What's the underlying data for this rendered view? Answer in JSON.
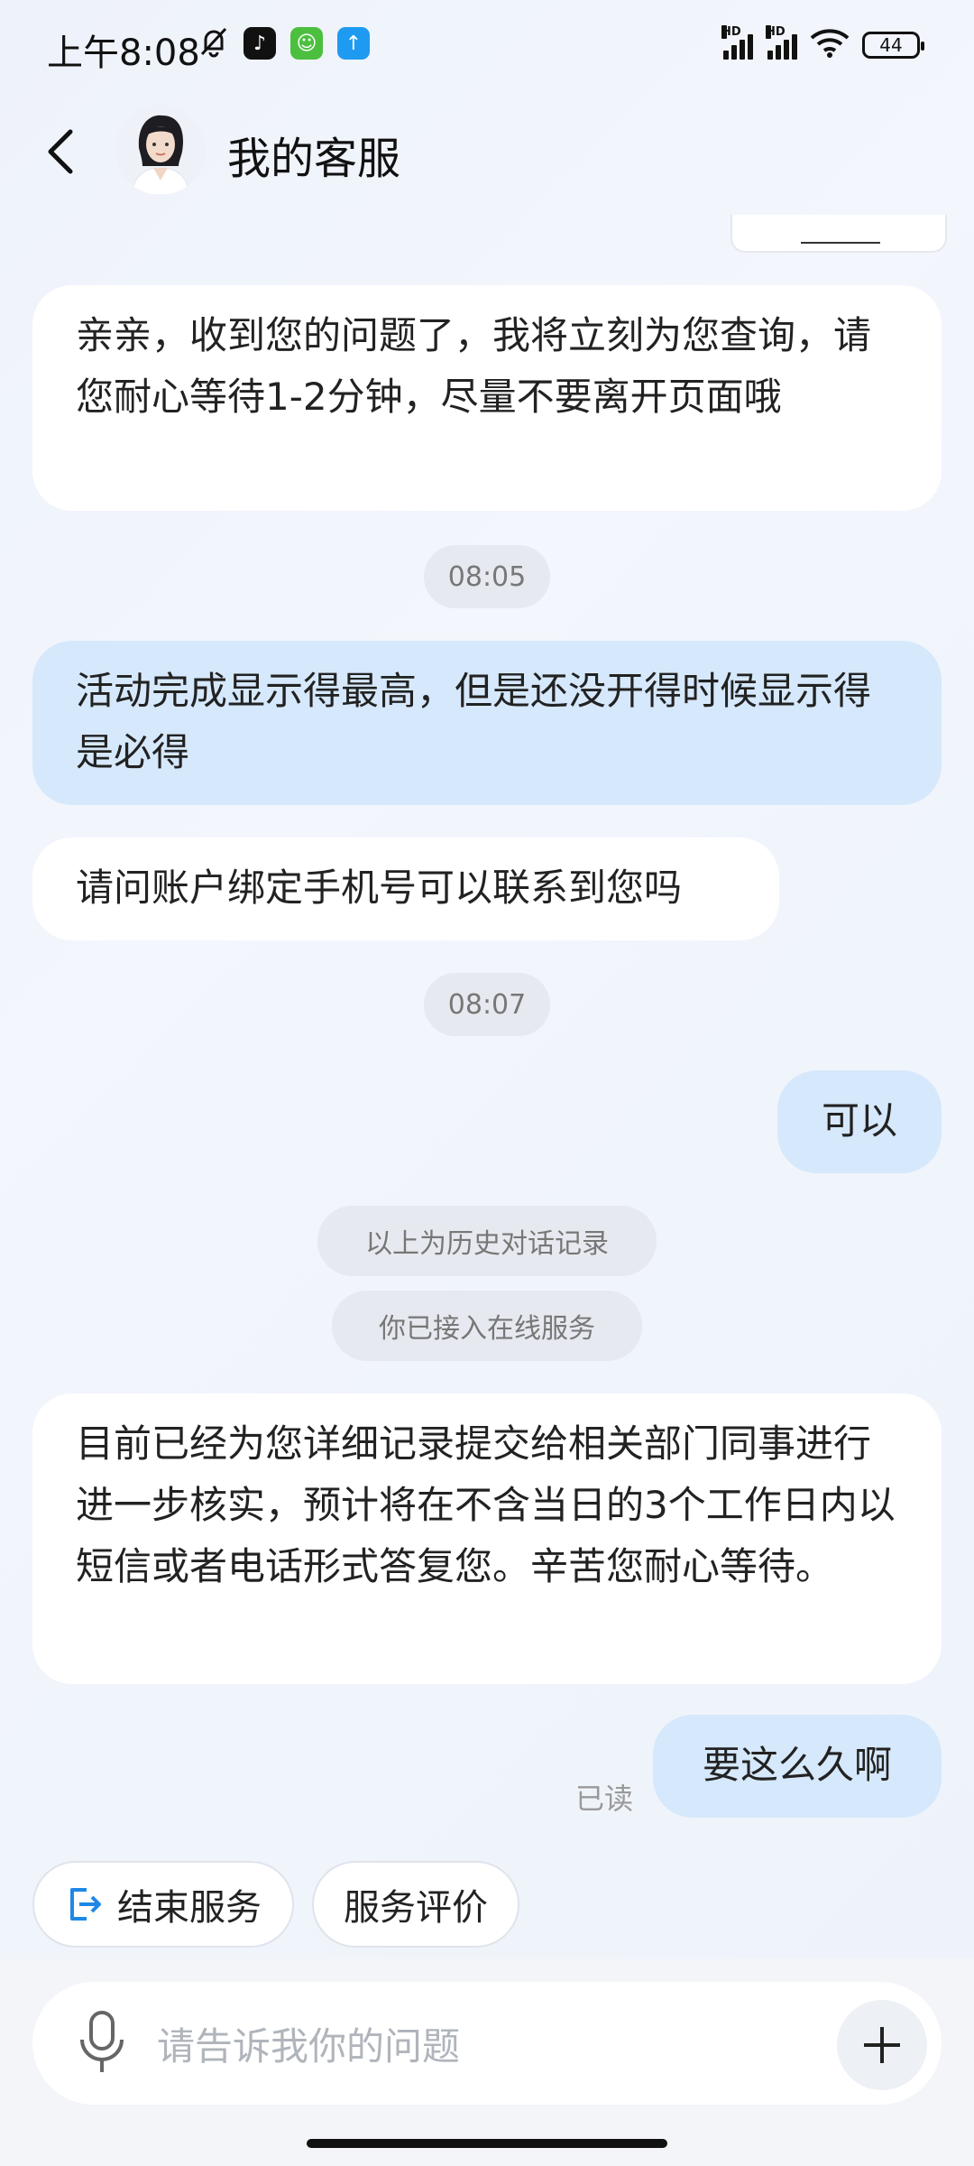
{
  "status_bar": {
    "time": "上午8:08",
    "battery": "44",
    "hd": "HD"
  },
  "header": {
    "title": "我的客服"
  },
  "messages": [
    {
      "text": "亲亲，收到您的问题了，我将立刻为您查询，请您耐心等待1-2分钟，尽量不要离开页面哦"
    },
    {
      "text": "08:05"
    },
    {
      "text": "活动完成显示得最高，但是还没开得时候显示得是必得"
    },
    {
      "text": "请问账户绑定手机号可以联系到您吗"
    },
    {
      "text": "08:07"
    },
    {
      "text": "可以"
    },
    {
      "text": "以上为历史对话记录"
    },
    {
      "text": "你已接入在线服务"
    },
    {
      "text": "目前已经为您详细记录提交给相关部门同事进行进一步核实，预计将在不含当日的3个工作日内以短信或者电话形式答复您。辛苦您耐心等待。"
    },
    {
      "text": "要这么久啊"
    }
  ],
  "read_status": "已读",
  "quick_actions": {
    "end_service": "结束服务",
    "rate_service": "服务评价"
  },
  "input": {
    "placeholder": "请告诉我你的问题"
  },
  "colors": {
    "user_bubble": "#d6e8fb",
    "agent_bubble": "#ffffff",
    "accent": "#1e88e5"
  }
}
